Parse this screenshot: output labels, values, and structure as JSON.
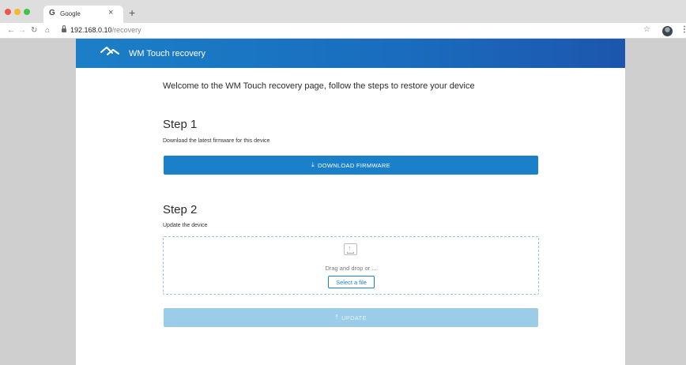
{
  "browser": {
    "tab_title": "Google",
    "tab_favicon": "G",
    "tab_close": "×",
    "new_tab": "+",
    "url_host": "192.168.0.10",
    "url_path": "/recovery",
    "nav_icons": [
      "back-arrow-icon",
      "forward-arrow-icon",
      "reload-icon",
      "home-icon"
    ]
  },
  "header": {
    "title": "WM Touch recovery",
    "accent": "#1a6cbe"
  },
  "main": {
    "welcome": "Welcome to the WM Touch recovery page, follow the steps to restore your device",
    "step1": {
      "title": "Step 1",
      "description": "Download  the latest firmware for this device",
      "button_label": "DOWNLOAD FIRMWARE"
    },
    "step2": {
      "title": "Step 2",
      "description": "Update the device",
      "drop_text": "Drag and drop or ...",
      "select_label": "Select a file",
      "update_label": "UPDATE"
    }
  },
  "colors": {
    "primary": "#1a80c9",
    "disabled": "#9bcde8"
  }
}
